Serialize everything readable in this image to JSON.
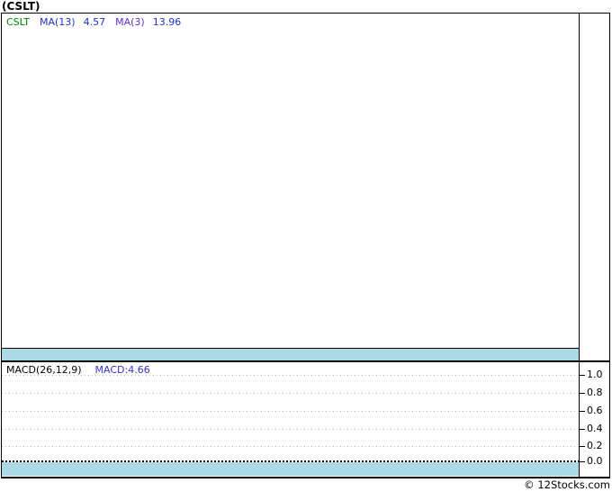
{
  "page": {
    "title": "(CSLT)",
    "copyright": "© 12Stocks.com"
  },
  "colors": {
    "background": "#ffffff",
    "border": "#000000",
    "band": "#add8e6",
    "gridline": "#b3b3b3",
    "zero_line": "#000000",
    "symbol_text": "#008800",
    "ma_text": "#2233cc",
    "macd_value_text": "#3333cc"
  },
  "main_chart": {
    "legend": {
      "symbol": "CSLT",
      "ma1_label": "MA(13)",
      "ma1_value": "4.57",
      "ma2_label": "MA(3)",
      "ma2_value": "13.96"
    }
  },
  "macd_panel": {
    "label": "MACD(26,12,9)",
    "value_label": "MACD:4.66",
    "ticks": [
      "1.0",
      "0.8",
      "0.6",
      "0.4",
      "0.2",
      "0.0"
    ]
  },
  "chart_data": [
    {
      "type": "line",
      "title": "(CSLT)",
      "subtitle": "price panel with moving averages",
      "series": [
        {
          "name": "CSLT",
          "color": "#008800",
          "values": []
        },
        {
          "name": "MA(13)",
          "last_value": 4.57,
          "color": "#2233cc",
          "values": []
        },
        {
          "name": "MA(3)",
          "last_value": 13.96,
          "color": "#5a33cc",
          "values": []
        }
      ],
      "xlabel": "",
      "ylabel": "",
      "grid": false,
      "legend_position": "top-left",
      "note": "plot area is empty - no price data rendered; light-blue volume band strip at bottom of panel; right price axis has no tick labels"
    },
    {
      "type": "line",
      "title": "MACD(26,12,9)",
      "series": [
        {
          "name": "MACD",
          "last_value": 4.66,
          "color": "#3333cc",
          "values": []
        }
      ],
      "xlabel": "",
      "ylabel": "",
      "ylim": [
        0.0,
        1.0
      ],
      "yticks": [
        1.0,
        0.8,
        0.6,
        0.4,
        0.2,
        0.0
      ],
      "grid": "horizontal dotted",
      "legend_position": "top-left",
      "note": "plot area is empty - no MACD line rendered; dense dotted zero line and light-blue band strip at bottom"
    }
  ]
}
